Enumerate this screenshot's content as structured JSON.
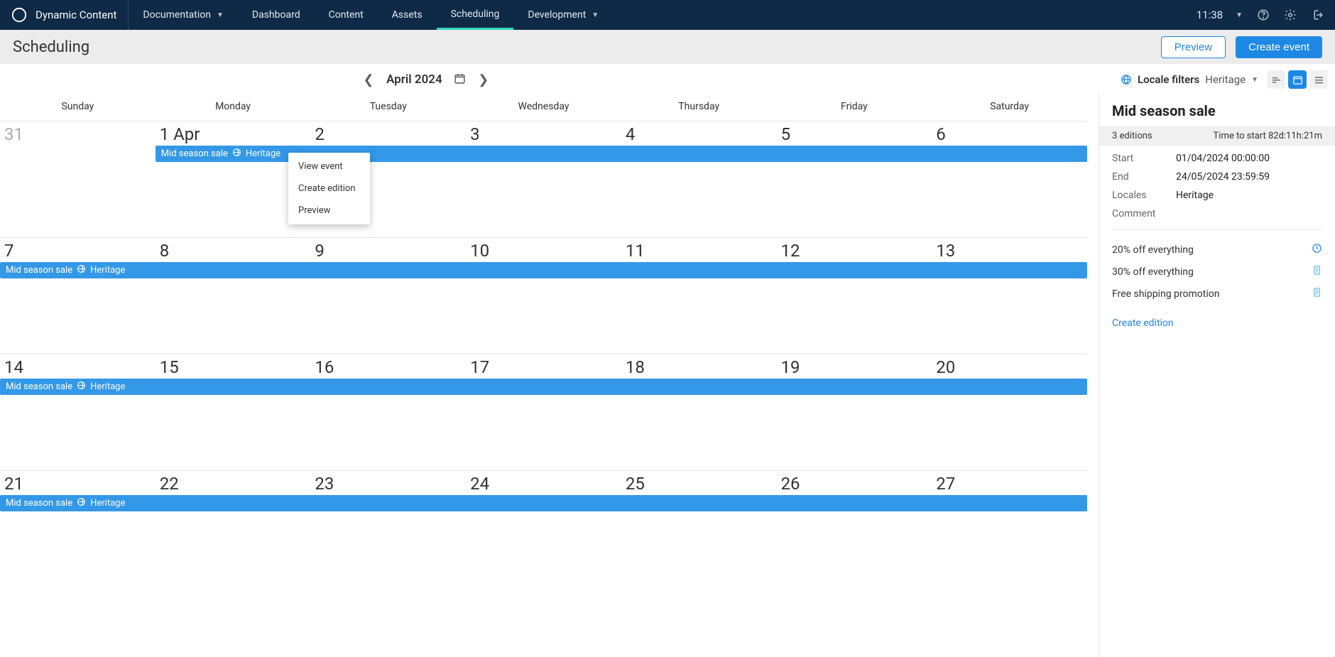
{
  "topbar": {
    "brand": "Dynamic Content",
    "nav": [
      {
        "label": "Documentation",
        "dropdown": true
      },
      {
        "label": "Dashboard"
      },
      {
        "label": "Content"
      },
      {
        "label": "Assets"
      },
      {
        "label": "Scheduling",
        "active": true
      },
      {
        "label": "Development",
        "dropdown": true
      }
    ],
    "time": "11:38"
  },
  "subheader": {
    "title": "Scheduling",
    "preview_btn": "Preview",
    "create_btn": "Create event"
  },
  "cal_header": {
    "month": "April 2024",
    "locale_label": "Locale filters",
    "locale_value": "Heritage"
  },
  "weekdays": [
    "Sunday",
    "Monday",
    "Tuesday",
    "Wednesday",
    "Thursday",
    "Friday",
    "Saturday"
  ],
  "weeks": [
    {
      "days": [
        "31",
        "1 Apr",
        "2",
        "3",
        "4",
        "5",
        "6"
      ],
      "prev_indices": [
        0
      ],
      "event": {
        "label": "Mid season sale",
        "tag": "Heritage",
        "starts_col": 1
      }
    },
    {
      "days": [
        "7",
        "8",
        "9",
        "10",
        "11",
        "12",
        "13"
      ],
      "event": {
        "label": "Mid season sale",
        "tag": "Heritage",
        "starts_col": 0
      }
    },
    {
      "days": [
        "14",
        "15",
        "16",
        "17",
        "18",
        "19",
        "20"
      ],
      "event": {
        "label": "Mid season sale",
        "tag": "Heritage",
        "starts_col": 0
      }
    },
    {
      "days": [
        "21",
        "22",
        "23",
        "24",
        "25",
        "26",
        "27"
      ],
      "event": {
        "label": "Mid season sale",
        "tag": "Heritage",
        "starts_col": 0
      }
    }
  ],
  "context_menu": [
    "View event",
    "Create edition",
    "Preview"
  ],
  "side": {
    "title": "Mid season sale",
    "editions_count": "3 editions",
    "countdown": "Time to start 82d:11h:21m",
    "meta": {
      "start_label": "Start",
      "start_value": "01/04/2024 00:00:00",
      "end_label": "End",
      "end_value": "24/05/2024 23:59:59",
      "locales_label": "Locales",
      "locales_value": "Heritage",
      "comment_label": "Comment",
      "comment_value": ""
    },
    "editions": [
      {
        "label": "20% off everything",
        "icon": "clock"
      },
      {
        "label": "30% off everything",
        "icon": "doc"
      },
      {
        "label": "Free shipping promotion",
        "icon": "doc"
      }
    ],
    "create_edition": "Create edition"
  }
}
